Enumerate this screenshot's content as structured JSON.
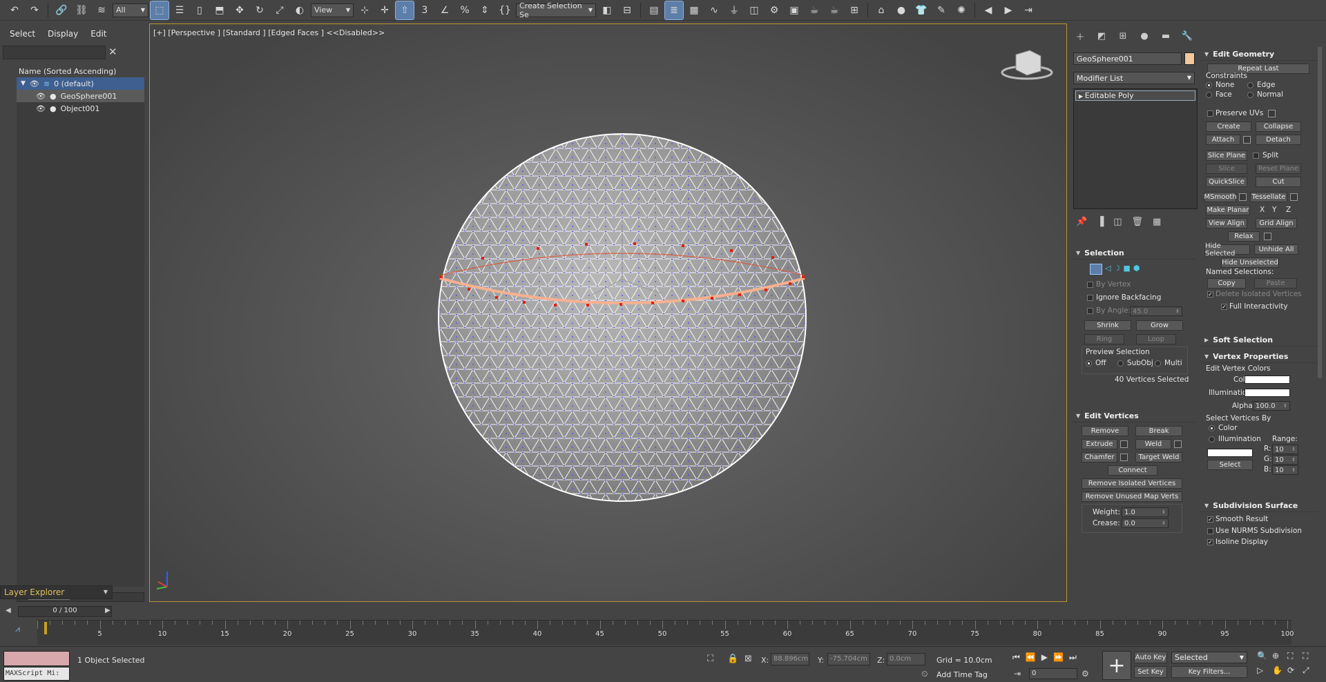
{
  "toolbar": {
    "filter_value": "All",
    "ref_coord": "View",
    "named_selection": "Create Selection Se"
  },
  "scene_explorer": {
    "menu": [
      "Select",
      "Display",
      "Edit"
    ],
    "column_header": "Name (Sorted Ascending)",
    "items": [
      {
        "label": "0 (default)"
      },
      {
        "label": "GeoSphere001"
      },
      {
        "label": "Object001"
      }
    ],
    "layer_explorer_label": "Layer Explorer"
  },
  "viewport": {
    "label": "[+] [Perspective ] [Standard ] [Edged Faces ] <<Disabled>>"
  },
  "command_panel": {
    "object_name": "GeoSphere001",
    "object_color": "#f5c79d",
    "modifier_list": "Modifier List",
    "stack_item": "Editable Poly",
    "selection": {
      "title": "Selection",
      "by_vertex": "By Vertex",
      "ignore_backfacing": "Ignore Backfacing",
      "by_angle": "By Angle:",
      "by_angle_value": "45.0",
      "shrink": "Shrink",
      "grow": "Grow",
      "ring": "Ring",
      "loop": "Loop",
      "preview_label": "Preview Selection",
      "preview_off": "Off",
      "preview_subobj": "SubObj",
      "preview_multi": "Multi",
      "status": "40 Vertices Selected"
    },
    "edit_vertices": {
      "title": "Edit Vertices",
      "remove": "Remove",
      "break": "Break",
      "extrude": "Extrude",
      "weld": "Weld",
      "chamfer": "Chamfer",
      "target_weld": "Target Weld",
      "connect": "Connect",
      "remove_isolated": "Remove Isolated Vertices",
      "remove_unused": "Remove Unused Map Verts",
      "weight_label": "Weight:",
      "weight_value": "1.0",
      "crease_label": "Crease:",
      "crease_value": "0.0"
    },
    "edit_geometry": {
      "title": "Edit Geometry",
      "repeat_last": "Repeat Last",
      "constraints": "Constraints",
      "c_none": "None",
      "c_edge": "Edge",
      "c_face": "Face",
      "c_normal": "Normal",
      "preserve_uvs": "Preserve UVs",
      "create": "Create",
      "collapse": "Collapse",
      "attach": "Attach",
      "detach": "Detach",
      "slice_plane": "Slice Plane",
      "split": "Split",
      "slice": "Slice",
      "reset_plane": "Reset Plane",
      "quickslice": "QuickSlice",
      "cut": "Cut",
      "msmooth": "MSmooth",
      "tessellate": "Tessellate",
      "make_planar": "Make Planar",
      "x": "X",
      "y": "Y",
      "z": "Z",
      "view_align": "View Align",
      "grid_align": "Grid Align",
      "relax": "Relax",
      "hide_selected": "Hide Selected",
      "unhide_all": "Unhide All",
      "hide_unselected": "Hide Unselected",
      "named_selections": "Named Selections:",
      "copy": "Copy",
      "paste": "Paste",
      "delete_isolated": "Delete Isolated Vertices",
      "full_interactivity": "Full Interactivity"
    },
    "soft_selection": {
      "title": "Soft Selection"
    },
    "vertex_properties": {
      "title": "Vertex Properties",
      "edit_vertex_colors": "Edit Vertex Colors",
      "color_label": "Color:",
      "illumination_label": "Illumination:",
      "alpha_label": "Alpha:",
      "alpha_value": "100.0",
      "select_vertices_by": "Select Vertices By",
      "by_color": "Color",
      "by_illumination": "Illumination",
      "range": "Range:",
      "r_label": "R:",
      "r_value": "10",
      "g_label": "G:",
      "g_value": "10",
      "b_label": "B:",
      "b_value": "10",
      "select": "Select"
    },
    "subdivision_surface": {
      "title": "Subdivision Surface",
      "smooth_result": "Smooth Result",
      "use_nurms": "Use NURMS Subdivision",
      "isoline": "Isoline Display"
    }
  },
  "timeline": {
    "slider_label": "0 / 100",
    "ticks": [
      "5",
      "10",
      "15",
      "20",
      "25",
      "30",
      "35",
      "40",
      "45",
      "50",
      "55",
      "60",
      "65",
      "70",
      "75",
      "80",
      "85",
      "90",
      "95",
      "100"
    ]
  },
  "status_bar": {
    "maxscript": "MAXScript Mi:",
    "selected_text": "1 Object Selected",
    "x_label": "X:",
    "x_value": "88.896cm",
    "y_label": "Y:",
    "y_value": "-75.704cm",
    "z_label": "Z:",
    "z_value": "0.0cm",
    "grid": "Grid = 10.0cm",
    "add_time_tag": "Add Time Tag",
    "auto_key": "Auto Key",
    "set_key": "Set Key",
    "selected_dropdown": "Selected",
    "key_filters": "Key Filters...",
    "frame_value": "0"
  }
}
